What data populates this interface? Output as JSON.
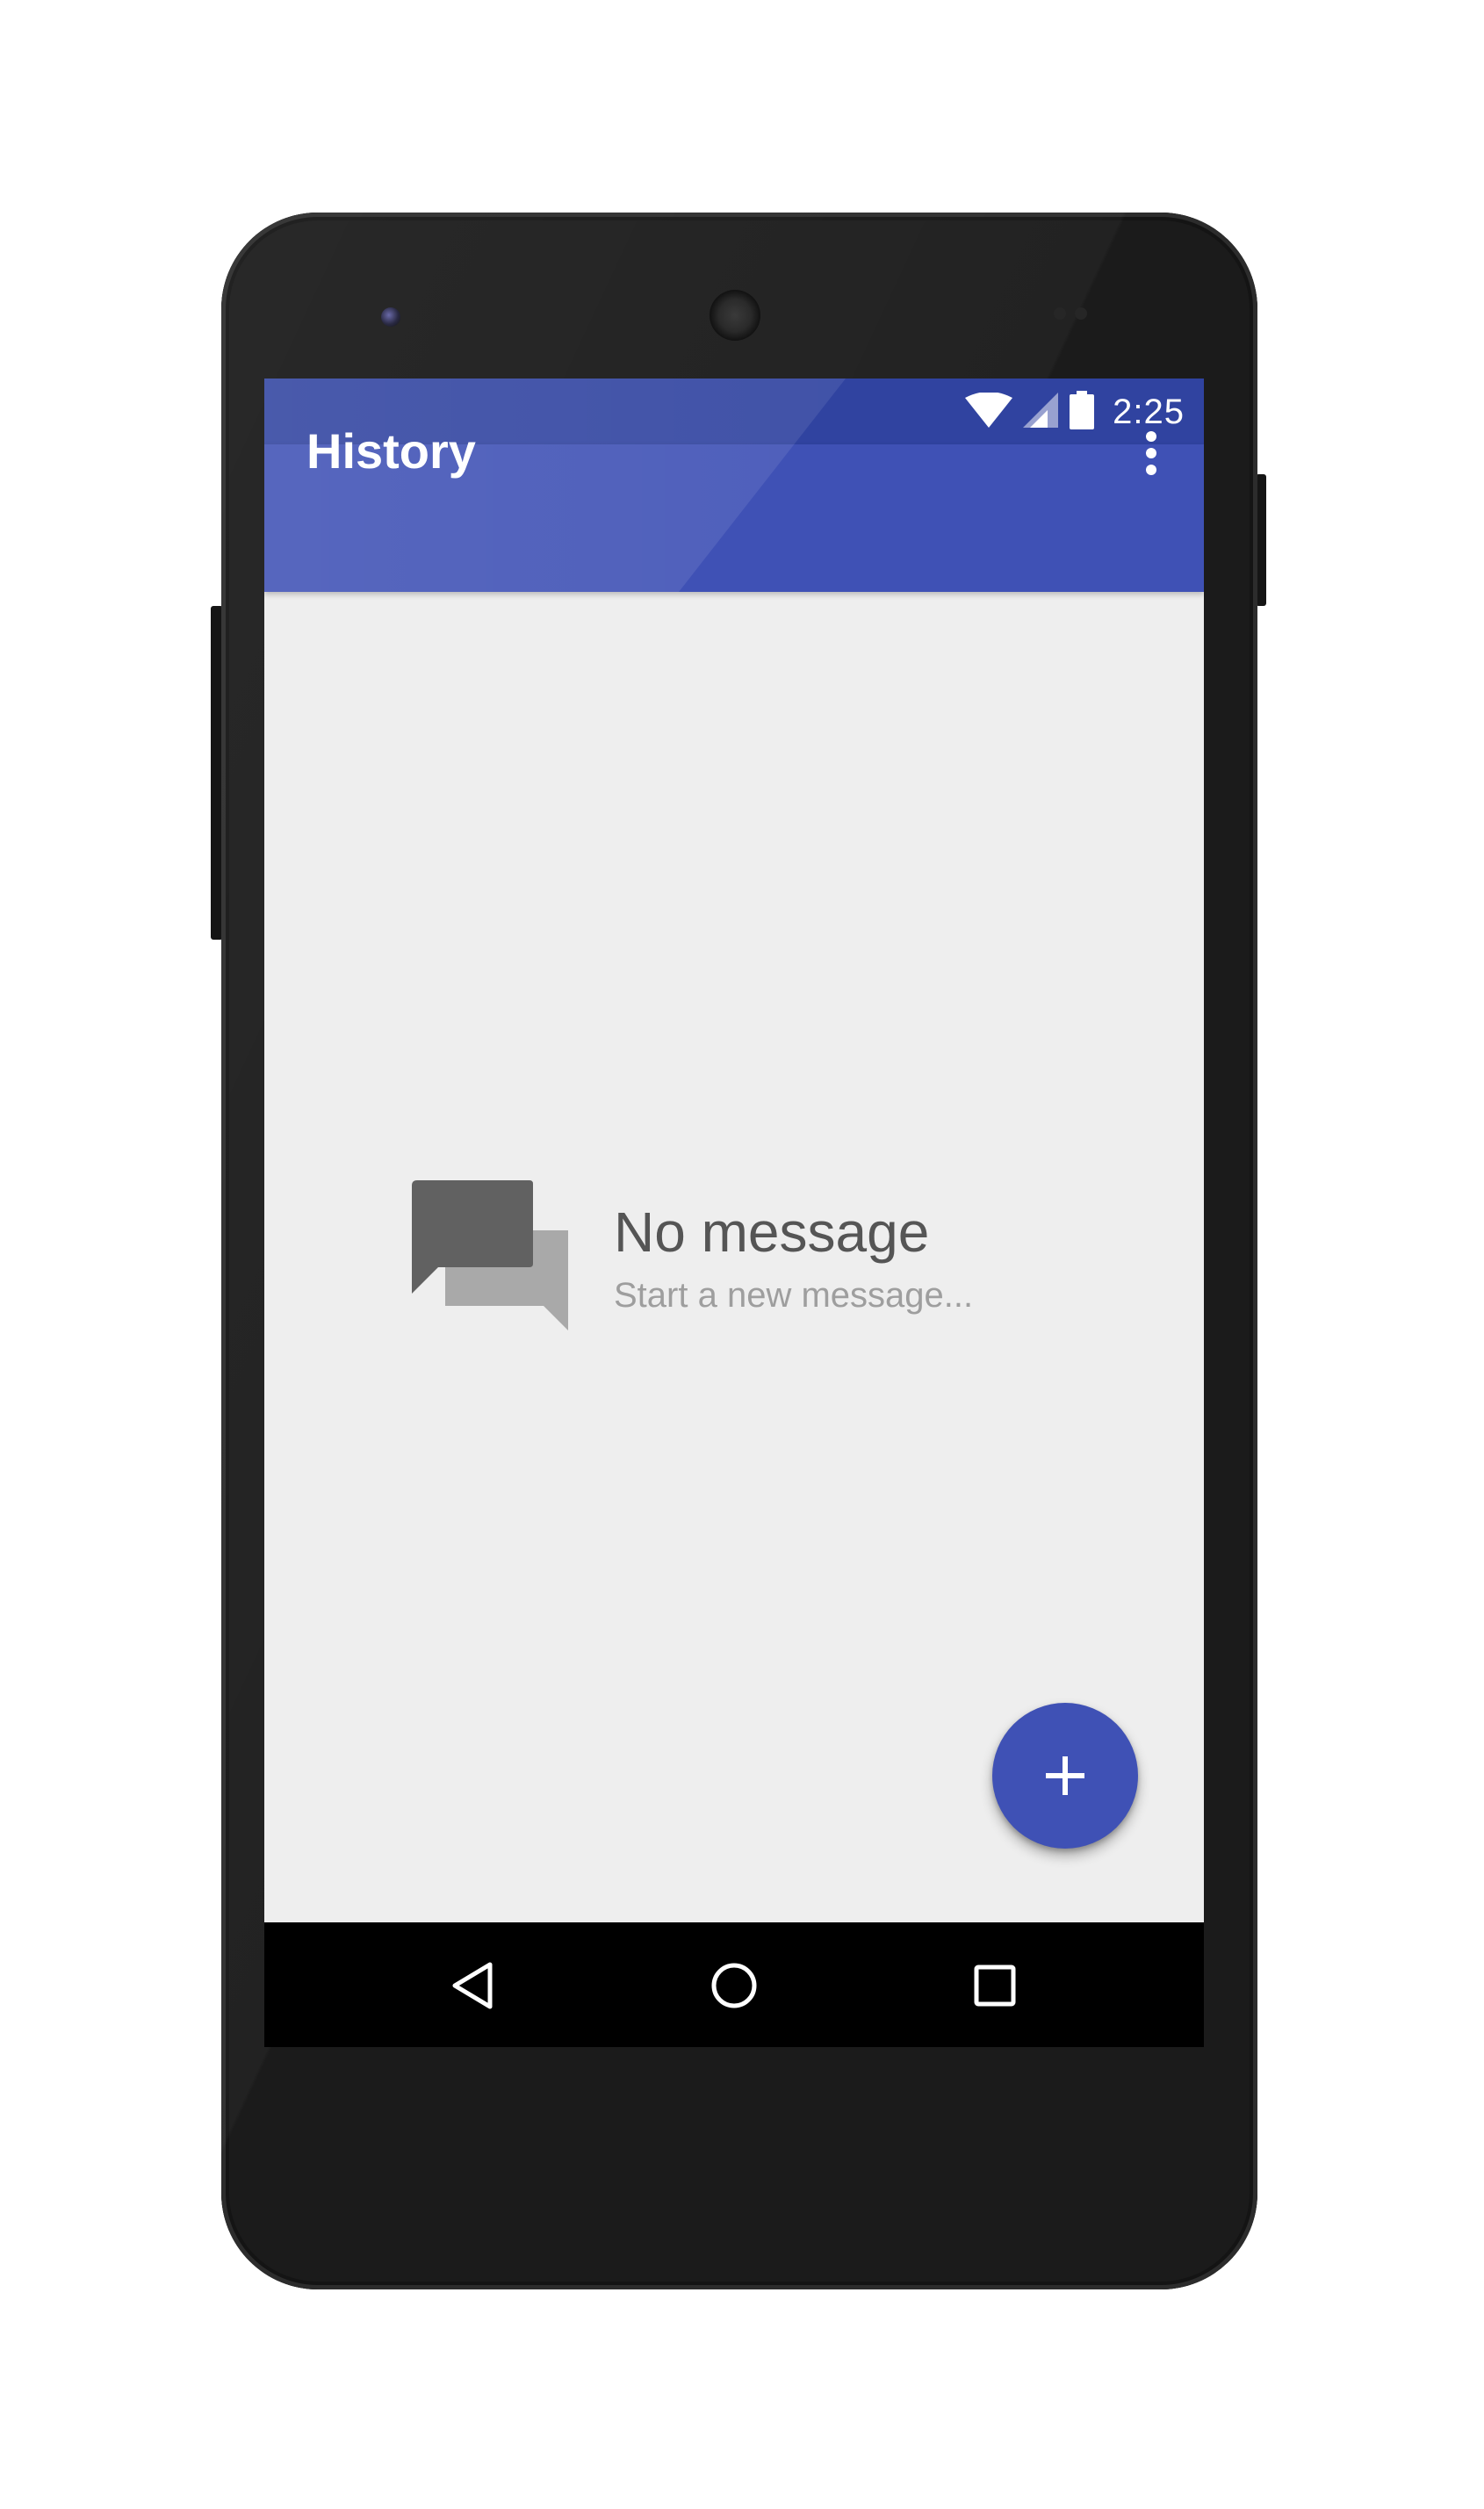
{
  "status_bar": {
    "time": "2:25",
    "icons": [
      "wifi-icon",
      "signal-icon",
      "battery-icon"
    ]
  },
  "toolbar": {
    "title": "History",
    "overflow_icon": "more-vert-icon"
  },
  "empty_state": {
    "icon": "chat-bubbles-icon",
    "title": "No message",
    "subtitle": "Start a new message..."
  },
  "fab": {
    "icon": "plus-icon"
  },
  "nav_bar": {
    "buttons": [
      "back-icon",
      "home-icon",
      "recents-icon"
    ]
  },
  "colors": {
    "primary": "#3f51b5",
    "primary_dark": "#3043a0",
    "background": "#eeeeee",
    "title_text": "#555555",
    "subtitle_text": "#9e9e9e"
  }
}
